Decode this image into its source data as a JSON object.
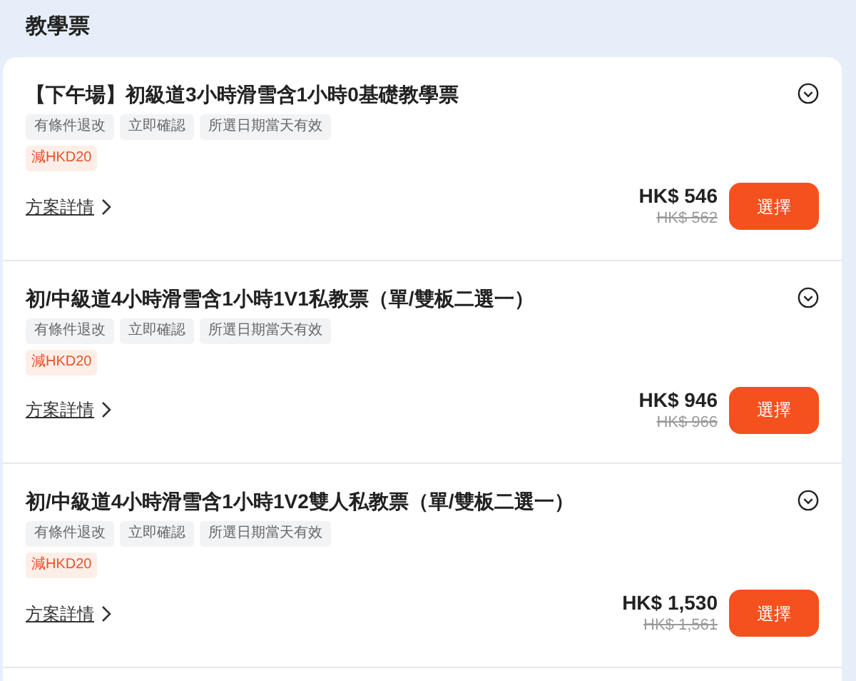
{
  "section_title": "教學票",
  "packages": [
    {
      "title": "【下午場】初級道3小時滑雪含1小時0基礎教學票",
      "tags": [
        "有條件退改",
        "立即確認",
        "所選日期當天有效"
      ],
      "discount": "減HKD20",
      "details_link": "方案詳情",
      "price": "HK$ 546",
      "original_price": "HK$ 562",
      "button": "選擇"
    },
    {
      "title": "初/中級道4小時滑雪含1小時1V1私教票（單/雙板二選一）",
      "tags": [
        "有條件退改",
        "立即確認",
        "所選日期當天有效"
      ],
      "discount": "減HKD20",
      "details_link": "方案詳情",
      "price": "HK$ 946",
      "original_price": "HK$ 966",
      "button": "選擇"
    },
    {
      "title": "初/中級道4小時滑雪含1小時1V2雙人私教票（單/雙板二選一）",
      "tags": [
        "有條件退改",
        "立即確認",
        "所選日期當天有效"
      ],
      "discount": "減HKD20",
      "details_link": "方案詳情",
      "price": "HK$ 1,530",
      "original_price": "HK$ 1,561",
      "button": "選擇"
    }
  ]
}
